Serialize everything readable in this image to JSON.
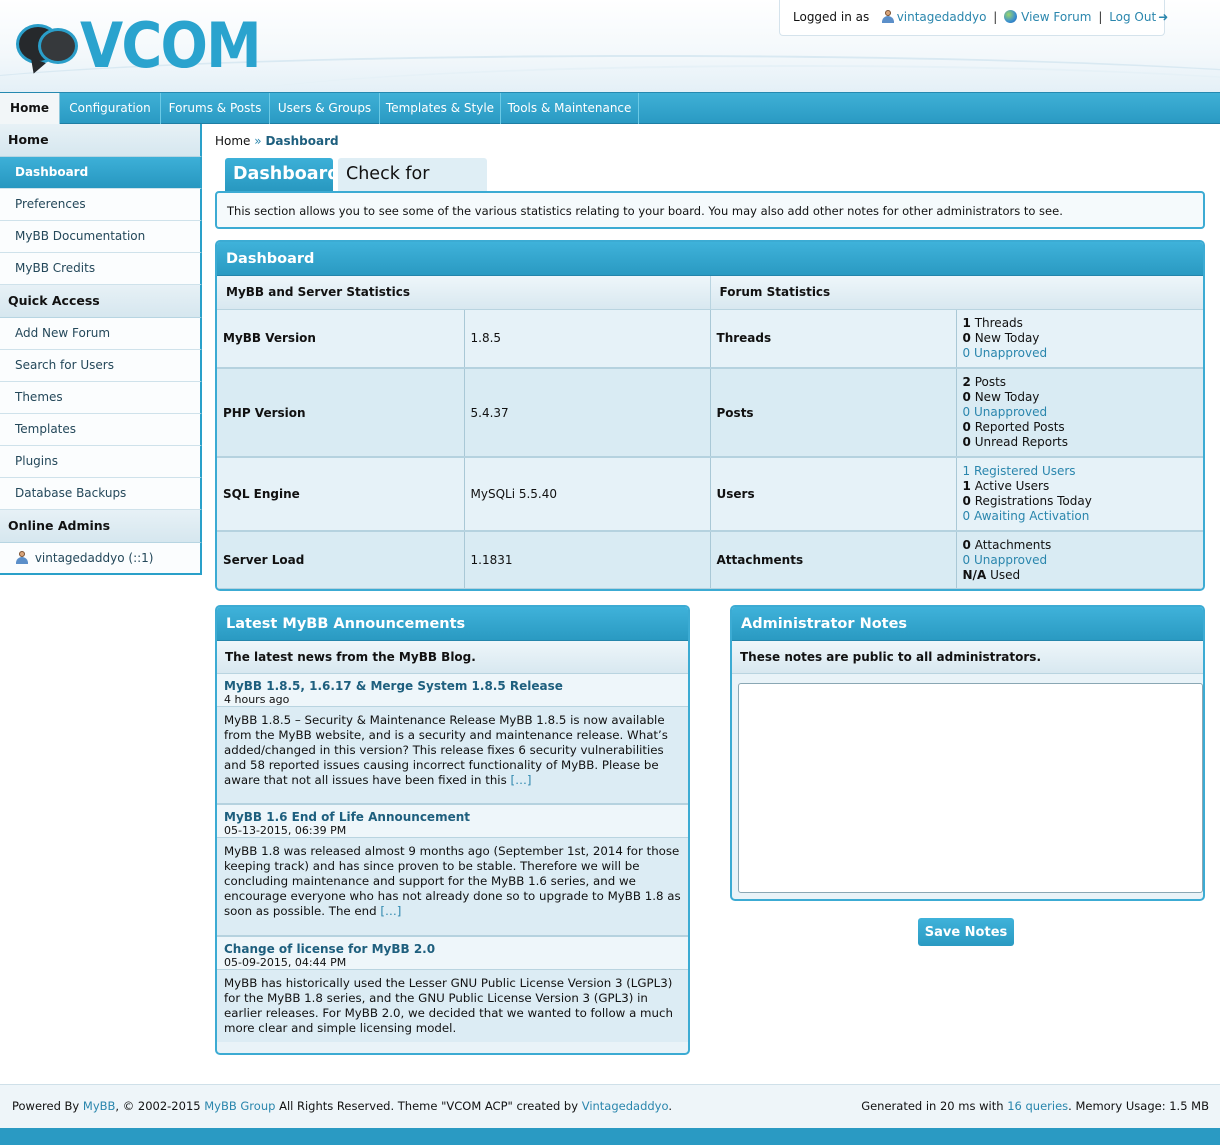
{
  "header": {
    "logo_text": "VCOM",
    "logged_in_label": "Logged in as",
    "username": "vintagedaddyo",
    "separator": "|",
    "view_forum": "View Forum",
    "log_out": "Log Out",
    "brand_color": "#2aa3ce"
  },
  "menu": {
    "items": [
      "Home",
      "Configuration",
      "Forums & Posts",
      "Users & Groups",
      "Templates & Style",
      "Tools & Maintenance"
    ],
    "active": "Home"
  },
  "sidebar": {
    "home_title": "Home",
    "home_items": [
      "Dashboard",
      "Preferences",
      "MyBB Documentation",
      "MyBB Credits"
    ],
    "quick_title": "Quick Access",
    "quick_items": [
      "Add New Forum",
      "Search for Users",
      "Themes",
      "Templates",
      "Plugins",
      "Database Backups"
    ],
    "online_title": "Online Admins",
    "online_admin": "vintagedaddyo (::1)"
  },
  "breadcrumb": {
    "home": "Home",
    "sep": "»",
    "current": "Dashboard"
  },
  "tabs": {
    "dashboard": "Dashboard",
    "updates": "Check for Updates"
  },
  "intro": "This section allows you to see some of the various statistics relating to your board. You may also add other notes for other administrators to see.",
  "dashboard": {
    "title": "Dashboard",
    "col1": "MyBB and Server Statistics",
    "col2": "Forum Statistics",
    "rows": [
      {
        "label": "MyBB Version",
        "value": "1.8.5",
        "flabel": "Threads"
      },
      {
        "label": "PHP Version",
        "value": "5.4.37",
        "flabel": "Posts"
      },
      {
        "label": "SQL Engine",
        "value": "MySQLi 5.5.40",
        "flabel": "Users"
      },
      {
        "label": "Server Load",
        "value": "1.1831",
        "flabel": "Attachments"
      }
    ],
    "threads": {
      "n1": "1",
      "t1": "Threads",
      "n2": "0",
      "t2": "New Today",
      "n3": "0",
      "t3": "Unapproved"
    },
    "posts": {
      "n1": "2",
      "t1": "Posts",
      "n2": "0",
      "t2": "New Today",
      "n3": "0",
      "t3": "Unapproved",
      "n4": "0",
      "t4": "Reported Posts",
      "n5": "0",
      "t5": "Unread Reports"
    },
    "users": {
      "n1": "1",
      "t1": "Registered Users",
      "n2": "1",
      "t2": "Active Users",
      "n3": "0",
      "t3": "Registrations Today",
      "n4": "0",
      "t4": "Awaiting Activation"
    },
    "attachments": {
      "n1": "0",
      "t1": "Attachments",
      "n2": "0",
      "t2": "Unapproved",
      "n3": "N/A",
      "t3": "Used"
    }
  },
  "news": {
    "title": "Latest MyBB Announcements",
    "subtitle": "The latest news from the MyBB Blog.",
    "items": [
      {
        "title": "MyBB 1.8.5, 1.6.17 & Merge System 1.8.5 Release",
        "date": "4 hours ago",
        "body": "MyBB 1.8.5 – Security & Maintenance Release MyBB 1.8.5 is now available from the MyBB website, and is a security and maintenance release. What’s added/changed in this version? This release fixes 6 security vulnerabilities and 58 reported issues causing incorrect functionality of MyBB. Please be aware that not all issues have been fixed in this",
        "more": "[…]"
      },
      {
        "title": "MyBB 1.6 End of Life Announcement",
        "date": "05-13-2015, 06:39 PM",
        "body": "MyBB 1.8 was released almost 9 months ago (September 1st, 2014 for those keeping track) and has since proven to be stable. Therefore we will be concluding maintenance and support for the MyBB 1.6 series, and we encourage everyone who has not already done so to upgrade to MyBB 1.8 as soon as possible. The end",
        "more": "[…]"
      },
      {
        "title": "Change of license for MyBB 2.0",
        "date": "05-09-2015, 04:44 PM",
        "body": "MyBB has historically used the Lesser GNU Public License Version 3 (LGPL3) for the MyBB 1.8 series, and the GNU Public License Version 3 (GPL3) in earlier releases. For MyBB 2.0, we decided that we wanted to follow a much more clear and simple licensing model.",
        "more": ""
      }
    ]
  },
  "notes": {
    "title": "Administrator Notes",
    "subtitle": "These notes are public to all administrators.",
    "value": "",
    "save_label": "Save Notes"
  },
  "footer": {
    "powered": "Powered By",
    "mybb": "MyBB",
    "copy": ", © 2002-2015",
    "group": "MyBB Group",
    "rights": "All Rights Reserved.  Theme \"VCOM ACP\" created by",
    "author": "Vintagedaddyo",
    "generated_pre": "Generated in 20 ms with",
    "queries": "16 queries",
    "generated_post": ". Memory Usage: 1.5 MB"
  }
}
